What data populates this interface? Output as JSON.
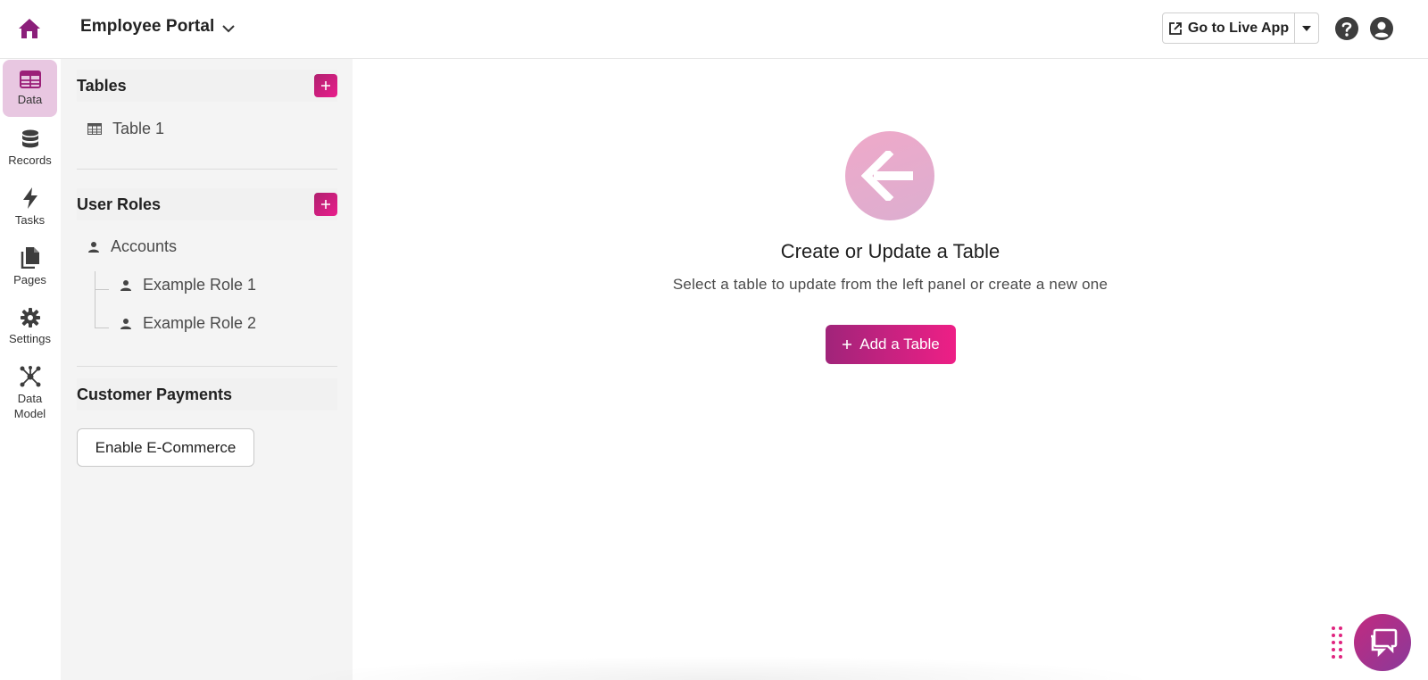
{
  "header": {
    "app_name": "Employee Portal",
    "live_button_label": "Go to Live App"
  },
  "nav": {
    "items": [
      {
        "label": "Data",
        "icon": "table-icon",
        "active": true
      },
      {
        "label": "Records",
        "icon": "database-icon"
      },
      {
        "label": "Tasks",
        "icon": "bolt-icon"
      },
      {
        "label": "Pages",
        "icon": "pages-icon"
      },
      {
        "label": "Settings",
        "icon": "gear-icon"
      },
      {
        "label": "Data Model",
        "label_line1": "Data",
        "label_line2": "Model",
        "icon": "network-icon"
      }
    ]
  },
  "panel": {
    "tables": {
      "title": "Tables",
      "items": [
        "Table 1"
      ]
    },
    "user_roles": {
      "title": "User Roles",
      "root": "Accounts",
      "children": [
        "Example Role 1",
        "Example Role 2"
      ]
    },
    "payments": {
      "title": "Customer Payments",
      "button_label": "Enable E-Commerce"
    }
  },
  "main": {
    "title": "Create or Update a Table",
    "subtitle": "Select a table to update from the left panel or create a new one",
    "button_label": "Add a Table"
  },
  "colors": {
    "accent": "#e91e8c",
    "accent_dark": "#a0247a",
    "nav_active": "#e8c7e1",
    "brand_home": "#8b1f7a"
  }
}
